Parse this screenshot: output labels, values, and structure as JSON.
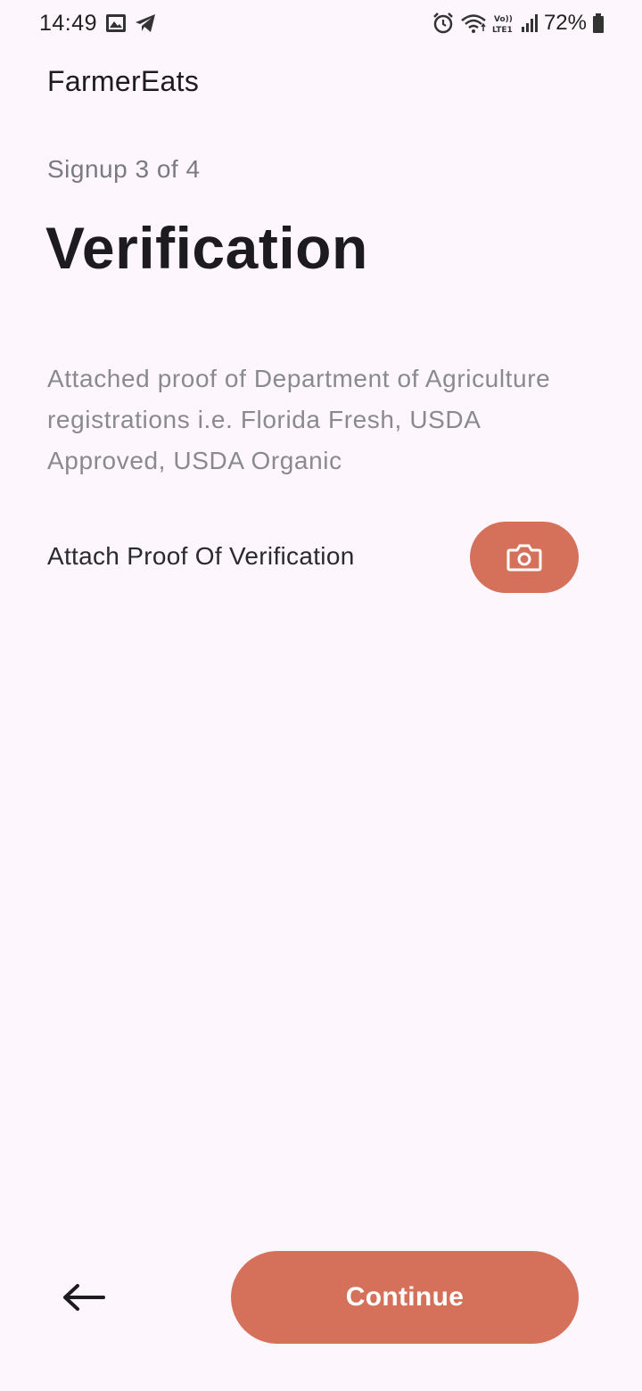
{
  "status_bar": {
    "time": "14:49",
    "battery": "72%",
    "icons_left": [
      "image-icon",
      "telegram-icon"
    ],
    "icons_right": [
      "alarm-icon",
      "wifi-icon",
      "volte-icon",
      "signal-icon",
      "battery-icon"
    ]
  },
  "app": {
    "title": "FarmerEats"
  },
  "signup": {
    "step": "Signup 3 of 4",
    "title": "Verification",
    "description": "Attached proof of Department of Agriculture registrations i.e. Florida Fresh, USDA Approved, USDA Organic",
    "attach_label": "Attach Proof Of Verification",
    "attach_icon": "camera-icon"
  },
  "footer": {
    "back_icon": "arrow-left-icon",
    "continue_label": "Continue"
  },
  "colors": {
    "accent": "#D5715B",
    "background": "#FDF7FD",
    "muted_text": "#8A8A8E"
  }
}
